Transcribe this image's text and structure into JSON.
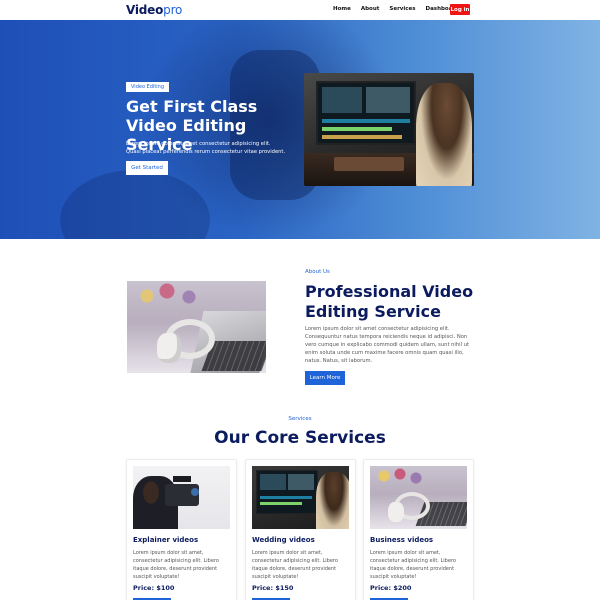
{
  "nav": {
    "logo_main": "Video",
    "logo_accent": "pro",
    "links": [
      "Home",
      "About",
      "Services",
      "Dashboard"
    ],
    "login_label": "Log in"
  },
  "hero": {
    "badge": "Video Editing",
    "title": "Get First Class Video Editing Service",
    "text": "Lorem ipsum dolor sit amet consectetur adipisicing elit. Quasi placeat perferendis rerum consectetur vitae provident.",
    "button_label": "Get Started"
  },
  "about": {
    "tag": "About Us",
    "title": "Professional Video Editing Service",
    "text": "Lorem ipsum dolor sit amet consectetur adipisicing elit. Consequuntur natus tempora reiciendis neque id adipisci. Non vero cumque in explicabo commodi quidem ullam, sunt nihil ut enim soluta unde cum maxime facere omnis quam quasi illo, natus. Natus, sit laborum.",
    "button_label": "Learn More"
  },
  "services": {
    "tag": "Services",
    "title": "Our Core Services",
    "cards": [
      {
        "title": "Explainer videos",
        "text": "Lorem ipsum dolor sit amet, consectetur adipisicing elit. Libero itaque dolore, deserunt provident suscipit voluptate!",
        "price": "Price: $100"
      },
      {
        "title": "Wedding videos",
        "text": "Lorem ipsum dolor sit amet, consectetur adipisicing elit. Libero itaque dolore, deserunt provident suscipit voluptate!",
        "price": "Price: $150"
      },
      {
        "title": "Business videos",
        "text": "Lorem ipsum dolor sit amet, consectetur adipisicing elit. Libero itaque dolore, deserunt provident suscipit voluptate!",
        "price": "Price: $200"
      }
    ]
  },
  "colors": {
    "brand_navy": "#0b1b5e",
    "accent_blue": "#1f63d9",
    "login_red": "#ee1515"
  }
}
